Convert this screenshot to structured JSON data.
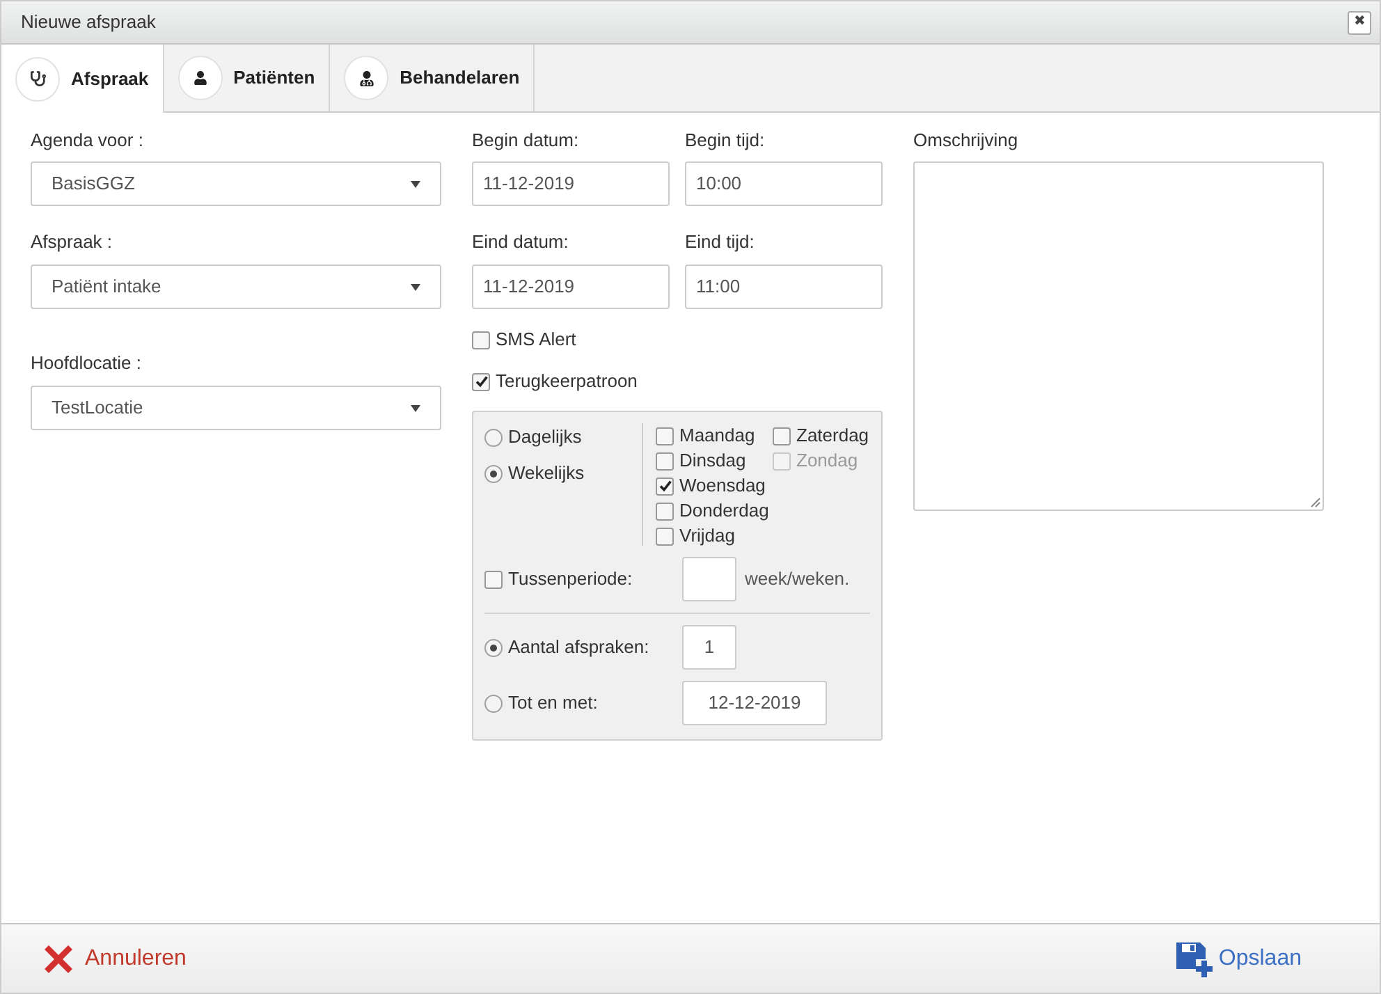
{
  "window": {
    "title": "Nieuwe afspraak",
    "close": "✖"
  },
  "tabs": [
    {
      "label": "Afspraak",
      "selected": true,
      "kind": "stethoscope"
    },
    {
      "label": "Patiënten",
      "selected": false,
      "kind": "user"
    },
    {
      "label": "Behandelaren",
      "selected": false,
      "kind": "doctor"
    }
  ],
  "left": [
    {
      "label": "Agenda voor :",
      "value": "BasisGGZ"
    },
    {
      "label": "Afspraak :",
      "value": "Patiënt intake"
    },
    {
      "label": "Hoofdlocatie :",
      "value": "TestLocatie"
    }
  ],
  "begin_datum": {
    "label": "Begin datum:",
    "value": "11-12-2019"
  },
  "begin_tijd": {
    "label": "Begin tijd:",
    "value": "10:00"
  },
  "eind_datum": {
    "label": "Eind datum:",
    "value": "11-12-2019"
  },
  "eind_tijd": {
    "label": "Eind tijd:",
    "value": "11:00"
  },
  "sms_alert": {
    "label": "SMS Alert",
    "checked": false
  },
  "terugkeerpatroon": {
    "label": "Terugkeerpatroon",
    "checked": true
  },
  "frequency": [
    {
      "label": "Dagelijks",
      "selected": false
    },
    {
      "label": "Wekelijks",
      "selected": true
    }
  ],
  "days": [
    {
      "label": "Maandag",
      "checked": false,
      "disabled": false
    },
    {
      "label": "Dinsdag",
      "checked": false,
      "disabled": false
    },
    {
      "label": "Woensdag",
      "checked": true,
      "disabled": false
    },
    {
      "label": "Donderdag",
      "checked": false,
      "disabled": false
    },
    {
      "label": "Vrijdag",
      "checked": false,
      "disabled": false
    },
    {
      "label": "Zaterdag",
      "checked": false,
      "disabled": false
    },
    {
      "label": "Zondag",
      "checked": false,
      "disabled": true
    }
  ],
  "tussenperiode": {
    "label": "Tussenperiode:",
    "checked": false,
    "unit": "week/weken."
  },
  "end_options": [
    {
      "label": "Aantal afspraken:",
      "selected": true,
      "value": "1"
    },
    {
      "label": "Tot en met:",
      "selected": false,
      "value": "12-12-2019"
    }
  ],
  "omschrijving": {
    "label": "Omschrijving"
  },
  "footer": {
    "cancel": "Annuleren",
    "save": "Opslaan"
  }
}
